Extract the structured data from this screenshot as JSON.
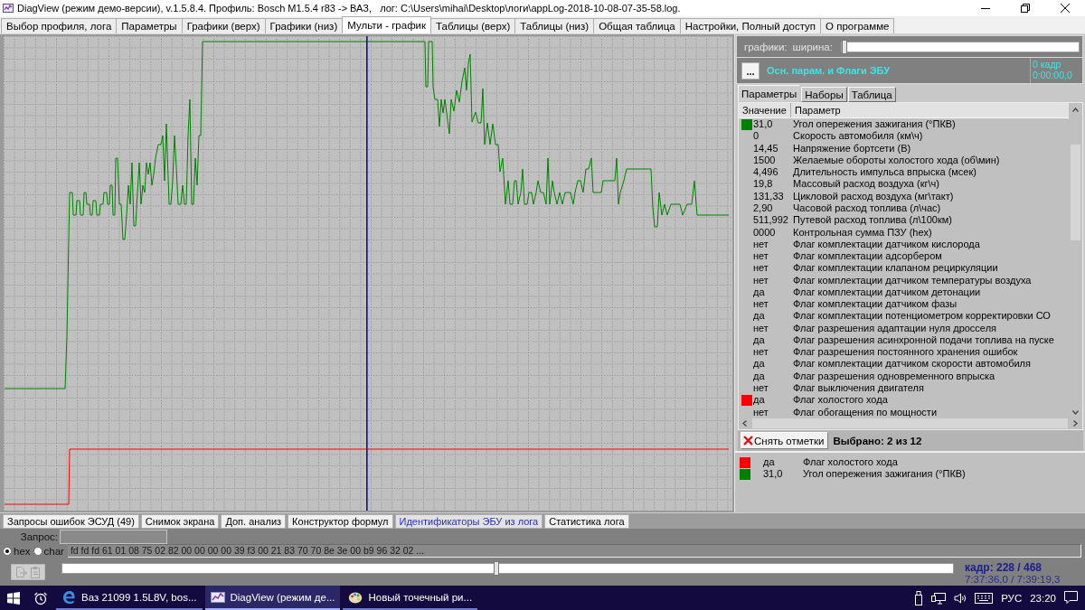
{
  "window": {
    "title": "DiagView (режим демо-версии), v.1.5.8.4. Профиль: Bosch M1.5.4 r83 -> ВАЗ,   лог: C:\\Users\\mihai\\Desktop\\логи\\appLog-2018-10-08-07-35-58.log."
  },
  "tabs": [
    {
      "label": "Выбор профиля, лога",
      "selected": false
    },
    {
      "label": "Параметры",
      "selected": false
    },
    {
      "label": "Графики (верх)",
      "selected": false
    },
    {
      "label": "Графики (низ)",
      "selected": false
    },
    {
      "label": "Мульти - график",
      "selected": true
    },
    {
      "label": "Таблицы (верх)",
      "selected": false
    },
    {
      "label": "Таблицы (низ)",
      "selected": false
    },
    {
      "label": "Общая таблица",
      "selected": false
    },
    {
      "label": "Настройки, Полный доступ",
      "selected": false
    },
    {
      "label": "О программе",
      "selected": false
    }
  ],
  "graph_width": {
    "label": "графики:",
    "width_label": "ширина:",
    "level": 0
  },
  "parameter_set": {
    "button": "...",
    "title": "Осн. парам. и Флаги ЭБУ",
    "frame": "0 кадр",
    "time": "0:00:00,0"
  },
  "side_tabs": [
    {
      "label": "Параметры",
      "selected": true
    },
    {
      "label": "Наборы",
      "selected": false
    },
    {
      "label": "Таблица",
      "selected": false
    }
  ],
  "parameters": {
    "columns": [
      "Значение",
      "Параметр"
    ],
    "rows": [
      {
        "value": "31,0",
        "name": "Угол опережения зажигания (°ПКВ)",
        "color": "#008000"
      },
      {
        "value": "0",
        "name": "Скорость автомобиля (км\\ч)"
      },
      {
        "value": "14,45",
        "name": "Напряжение бортсети (В)"
      },
      {
        "value": "1500",
        "name": "Желаемые обороты холостого хода (об\\мин)"
      },
      {
        "value": "4,496",
        "name": "Длительность импульса впрыска (мсек)"
      },
      {
        "value": "19,8",
        "name": "Массовый расход воздуха (кг\\ч)"
      },
      {
        "value": "131,33",
        "name": "Цикловой расход воздуха (мг\\такт)"
      },
      {
        "value": "2,90",
        "name": "Часовой расход топлива (л\\час)"
      },
      {
        "value": "511,992",
        "name": "Путевой расход топлива (л\\100км)"
      },
      {
        "value": "0000",
        "name": "Контрольная сумма ПЗУ (hex)"
      },
      {
        "value": "нет",
        "name": "Флаг комплектации датчиком кислорода"
      },
      {
        "value": "нет",
        "name": "Флаг комплектации адсорбером"
      },
      {
        "value": "нет",
        "name": "Флаг комплектации клапаном рециркуляции"
      },
      {
        "value": "нет",
        "name": "Флаг комплектации датчиком температуры воздуха"
      },
      {
        "value": "да",
        "name": "Флаг комплектации датчиком детонации"
      },
      {
        "value": "нет",
        "name": "Флаг комплектации датчиком фазы"
      },
      {
        "value": "да",
        "name": "Флаг комплектации потенциометром корректировки СО"
      },
      {
        "value": "нет",
        "name": "Флаг разрешения адаптации нуля дросселя"
      },
      {
        "value": "да",
        "name": "Флаг разрешения асинхронной подачи топлива на пуске"
      },
      {
        "value": "нет",
        "name": "Флаг разрешения постоянного хранения ошибок"
      },
      {
        "value": "да",
        "name": "Флаг комплектации датчиком скорости автомобиля"
      },
      {
        "value": "да",
        "name": "Флаг разрешения одновременного впрыска"
      },
      {
        "value": "нет",
        "name": "Флаг выключения двигателя"
      },
      {
        "value": "да",
        "name": "Флаг холостого хода",
        "color": "#ff0000"
      },
      {
        "value": "нет",
        "name": "Флаг обогащения по мощности"
      }
    ]
  },
  "clear_button": {
    "label": "Снять отметки"
  },
  "selection_count": "Выбрано: 2 из 12",
  "selected_parameters": [
    {
      "value": "да",
      "name": "Флаг холостого хода",
      "color": "#ff0000"
    },
    {
      "value": "31,0",
      "name": "Угол опережения зажигания (°ПКВ)",
      "color": "#008000"
    }
  ],
  "bottom_tabs": [
    {
      "label": "Запросы ошибок ЭСУД (49)",
      "selected": false
    },
    {
      "label": "Снимок экрана",
      "selected": false
    },
    {
      "label": "Доп. анализ",
      "selected": false
    },
    {
      "label": "Конструктор формул",
      "selected": false
    },
    {
      "label": "Идентификаторы ЭБУ из лога",
      "selected": true
    },
    {
      "label": "Статистика лога",
      "selected": false
    }
  ],
  "query": {
    "label": "Запрос:"
  },
  "format": {
    "options": [
      {
        "label": "hex",
        "selected": true
      },
      {
        "label": "char",
        "selected": false
      }
    ],
    "response": "fd fd fd 61 01 08 75 02 82 00 00 00 00 39 f3 00 21 83 70 70 8e 3e 00 b9 96 32 02 ..."
  },
  "transfer_button": {
    "disabled": true
  },
  "timeline": {
    "level": 0.487,
    "frame": "кадр: 228 / 468",
    "time": "7:37:36,0 / 7:39:19,3"
  },
  "taskbar": {
    "apps": [
      {
        "label": "Ваз 21099 1.5L8V, bos...",
        "kind": "browser",
        "selected": false
      },
      {
        "label": "DiagView (режим де...",
        "kind": "diagview",
        "selected": true
      },
      {
        "label": "Новый точечный ри...",
        "kind": "paint",
        "selected": false
      }
    ],
    "language": "РУС",
    "clock": "23:20"
  }
}
